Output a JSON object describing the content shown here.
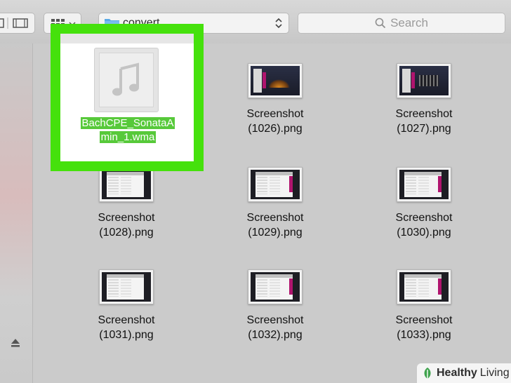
{
  "toolbar": {
    "path_label": "convert",
    "search_placeholder": "Search"
  },
  "selected_file": {
    "name_line1": "BachCPE_SonataA",
    "name_line2": "min_1.wma"
  },
  "files": [
    {
      "line1": "Screenshot",
      "line2": "(1026).png"
    },
    {
      "line1": "Screenshot",
      "line2": "(1027).png"
    },
    {
      "line1": "Screenshot",
      "line2": "(1028).png"
    },
    {
      "line1": "Screenshot",
      "line2": "(1029).png"
    },
    {
      "line1": "Screenshot",
      "line2": "(1030).png"
    },
    {
      "line1": "Screenshot",
      "line2": "(1031).png"
    },
    {
      "line1": "Screenshot",
      "line2": "(1032).png"
    },
    {
      "line1": "Screenshot",
      "line2": "(1033).png"
    }
  ],
  "watermark": {
    "bold": "Healthy",
    "regular": "Living"
  },
  "colors": {
    "highlight_frame": "#45e10c",
    "selection_label": "#57c93a",
    "folder": "#5aa9e6"
  },
  "icons": [
    "view-column-icon",
    "view-coverflow-icon",
    "arrange-grid-icon",
    "folder-icon",
    "updown-chevron-icon",
    "search-icon",
    "music-note-icon",
    "eject-icon",
    "leaf-logo-icon"
  ]
}
